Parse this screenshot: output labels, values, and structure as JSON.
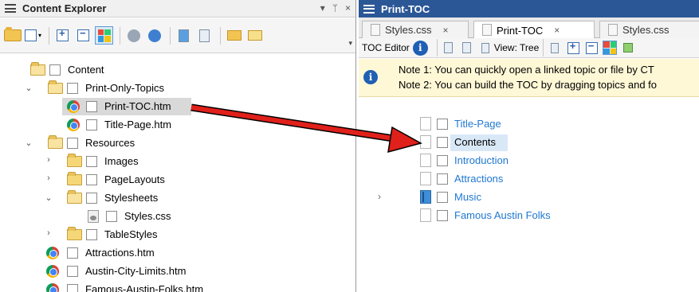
{
  "left_panel": {
    "title": "Content Explorer",
    "pin_glyph": "▾",
    "pin2_glyph": "ᛘ",
    "close_glyph": "×",
    "tree": [
      {
        "label": "Content",
        "type": "folder-open",
        "expanded": true
      },
      {
        "label": "Print-Only-Topics",
        "type": "folder-open",
        "expanded": true
      },
      {
        "label": "Print-TOC.htm",
        "type": "chrome-file",
        "selected": true
      },
      {
        "label": "Title-Page.htm",
        "type": "chrome-file"
      },
      {
        "label": "Resources",
        "type": "folder-open",
        "expanded": true
      },
      {
        "label": "Images",
        "type": "folder"
      },
      {
        "label": "PageLayouts",
        "type": "folder"
      },
      {
        "label": "Stylesheets",
        "type": "folder-open",
        "expanded": true
      },
      {
        "label": "Styles.css",
        "type": "css-file"
      },
      {
        "label": "TableStyles",
        "type": "folder"
      },
      {
        "label": "Attractions.htm",
        "type": "chrome-file"
      },
      {
        "label": "Austin-City-Limits.htm",
        "type": "chrome-file"
      },
      {
        "label": "Famous-Austin-Folks.htm",
        "type": "chrome-file"
      }
    ]
  },
  "right_panel": {
    "title": "Print-TOC",
    "tabs": [
      {
        "label": "Styles.css",
        "close": "×"
      },
      {
        "label": "Print-TOC",
        "close": "×",
        "active": true
      },
      {
        "label": "Styles.css"
      }
    ],
    "toolbar": {
      "editor_label": "TOC Editor",
      "view_label": "View: Tree"
    },
    "note": {
      "line1": "Note 1: You can quickly open a linked topic or file by CT",
      "line2": "Note 2: You can build the TOC by dragging topics and fo"
    },
    "toc": [
      {
        "label": "Title-Page",
        "linked": true
      },
      {
        "label": "Contents",
        "linked": false,
        "selected": true
      },
      {
        "label": "Introduction",
        "linked": true
      },
      {
        "label": "Attractions",
        "linked": true
      },
      {
        "label": "Music",
        "linked": true,
        "book": true,
        "collapsed": true
      },
      {
        "label": "Famous Austin Folks",
        "linked": true
      }
    ]
  },
  "colors": {
    "right_title_bg": "#2b5797",
    "link_blue": "#1f78d1",
    "note_bg": "#fff8d6",
    "arrow_red": "#e0201a"
  }
}
